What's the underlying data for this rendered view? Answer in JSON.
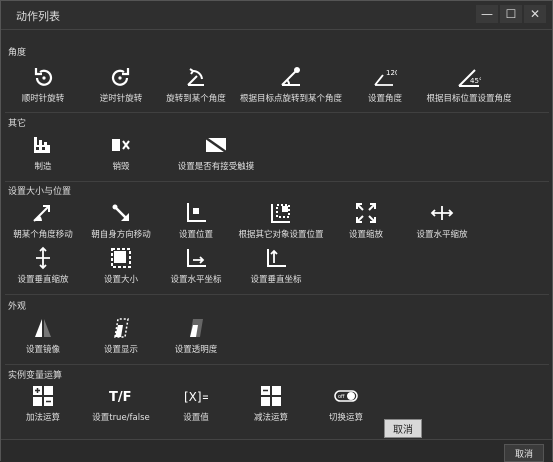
{
  "window": {
    "title": "动作列表"
  },
  "sections": [
    {
      "title": "角度",
      "items": [
        "顺时针旋转",
        "逆时针旋转",
        "旋转到某个角度",
        "根据目标点旋转到某个角度",
        "设置角度",
        "根据目标位置设置角度"
      ]
    },
    {
      "title": "其它",
      "items": [
        "制造",
        "销毁",
        "设置是否有接受触摸"
      ]
    },
    {
      "title": "设置大小与位置",
      "items": [
        "朝某个角度移动",
        "朝自身方向移动",
        "设置位置",
        "根据其它对象设置位置",
        "设置缩放",
        "设置水平缩放",
        "设置垂直缩放",
        "设置大小",
        "设置水平坐标",
        "设置垂直坐标"
      ]
    },
    {
      "title": "外观",
      "items": [
        "设置镜像",
        "设置显示",
        "设置透明度"
      ]
    },
    {
      "title": "实例变量运算",
      "items": [
        "加法运算",
        "设置true/false",
        "设置值",
        "减法运算",
        "切换运算"
      ]
    }
  ],
  "icon_text": {
    "angle_120": "120°",
    "angle_45": "45°",
    "tf": "T/F",
    "setval": "[X]=",
    "toggle": "off"
  },
  "tooltip": "取消",
  "cancel_label": "取消"
}
